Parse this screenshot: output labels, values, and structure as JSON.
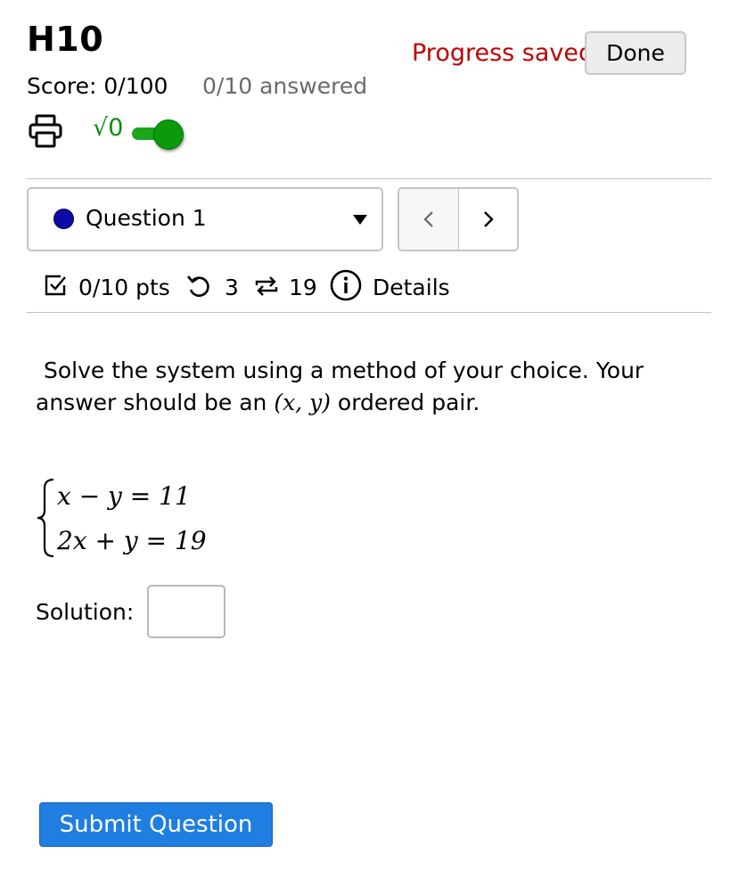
{
  "header": {
    "title": "H10",
    "progress_status": "Progress saved",
    "done_label": "Done",
    "score": "Score: 0/100",
    "answered": "0/10 answered"
  },
  "toolbar": {
    "print_icon": "printer-icon",
    "math_toggle_label": "√0",
    "math_toggle_state": "on"
  },
  "question_nav": {
    "selected": "Question 1",
    "dot_color": "#0a0aa8",
    "prev_icon": "chevron-left-icon",
    "next_icon": "chevron-right-icon"
  },
  "meta": {
    "points": "0/10 pts",
    "attempts": "3",
    "retries": "19",
    "details_label": "Details"
  },
  "question": {
    "prompt_before": "Solve the system using a method of your choice.  Your answer should be an ",
    "prompt_math": "(x, y)",
    "prompt_after": " ordered pair.",
    "equations": [
      "x − y = 11",
      "2x + y = 19"
    ],
    "solution_label": "Solution:",
    "solution_value": ""
  },
  "actions": {
    "submit_label": "Submit Question"
  },
  "colors": {
    "accent": "#1f7ee0",
    "saved_status": "#c00000",
    "toggle_on": "#0a9a0a"
  }
}
